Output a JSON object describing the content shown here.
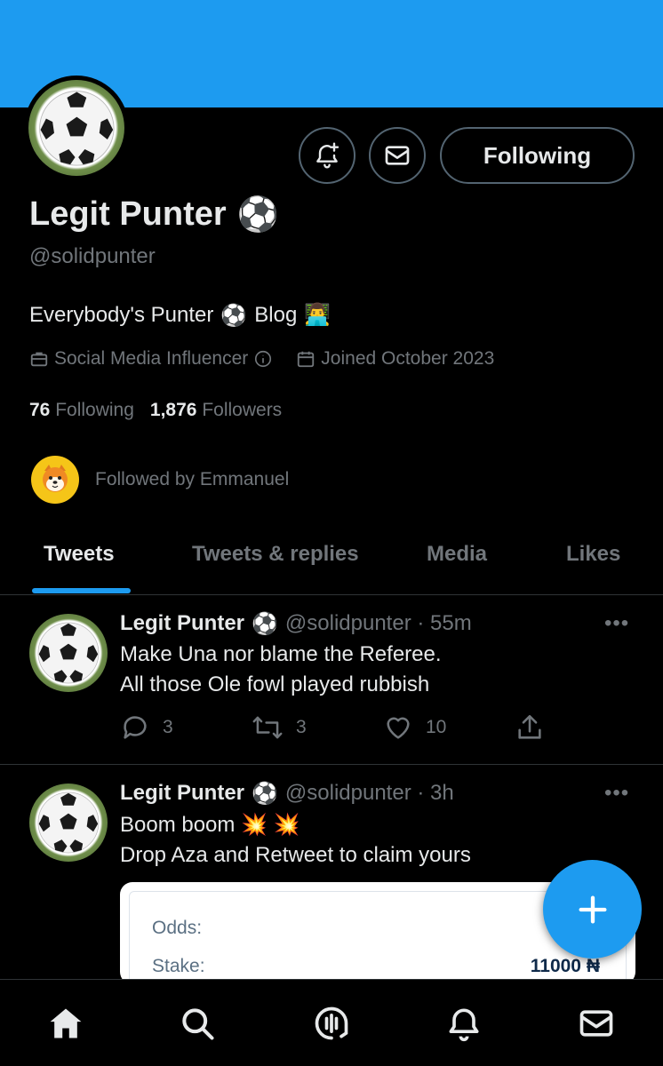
{
  "profile": {
    "banner_color": "#1d9bf0",
    "name": "Legit Punter",
    "name_emoji": "⚽",
    "handle": "@solidpunter",
    "bio_text1": "Everybody's Punter",
    "bio_emoji1": "⚽",
    "bio_text2": "Blog",
    "bio_emoji2": "👨‍💻",
    "category": "Social Media Influencer",
    "joined": "Joined October 2023",
    "following_count": "76",
    "following_label": "Following",
    "followers_count": "1,876",
    "followers_label": "Followers",
    "followed_by": "Followed by Emmanuel"
  },
  "actions": {
    "follow_label": "Following",
    "notify_icon": "bell-plus-icon",
    "message_icon": "mail-icon"
  },
  "tabs": [
    {
      "label": "Tweets",
      "active": true
    },
    {
      "label": "Tweets & replies",
      "active": false
    },
    {
      "label": "Media",
      "active": false
    },
    {
      "label": "Likes",
      "active": false
    }
  ],
  "tweets": [
    {
      "name": "Legit Punter",
      "emoji": "⚽",
      "handle_time": "@solidpunter · 55m",
      "more": "•••",
      "line1": "Make Una nor blame the Referee.",
      "line2": "All those Ole fowl played rubbish",
      "replies": "3",
      "retweets": "3",
      "likes": "10"
    },
    {
      "name": "Legit Punter",
      "emoji": "⚽",
      "handle_time": "@solidpunter · 3h",
      "more": "•••",
      "line1": "Boom boom 💥 💥",
      "line2": "Drop Aza and Retweet to claim yours",
      "card": {
        "odds_label": "Odds:",
        "stake_label": "Stake:",
        "stake_value": "11000 ₦"
      }
    }
  ],
  "colors": {
    "accent": "#1d9bf0",
    "background": "#000000",
    "text_primary": "#e7e9ea",
    "text_secondary": "#71767b",
    "border": "#2f3336"
  },
  "bottom_nav": [
    "home-icon",
    "search-icon",
    "spaces-icon",
    "bell-icon",
    "mail-icon"
  ]
}
